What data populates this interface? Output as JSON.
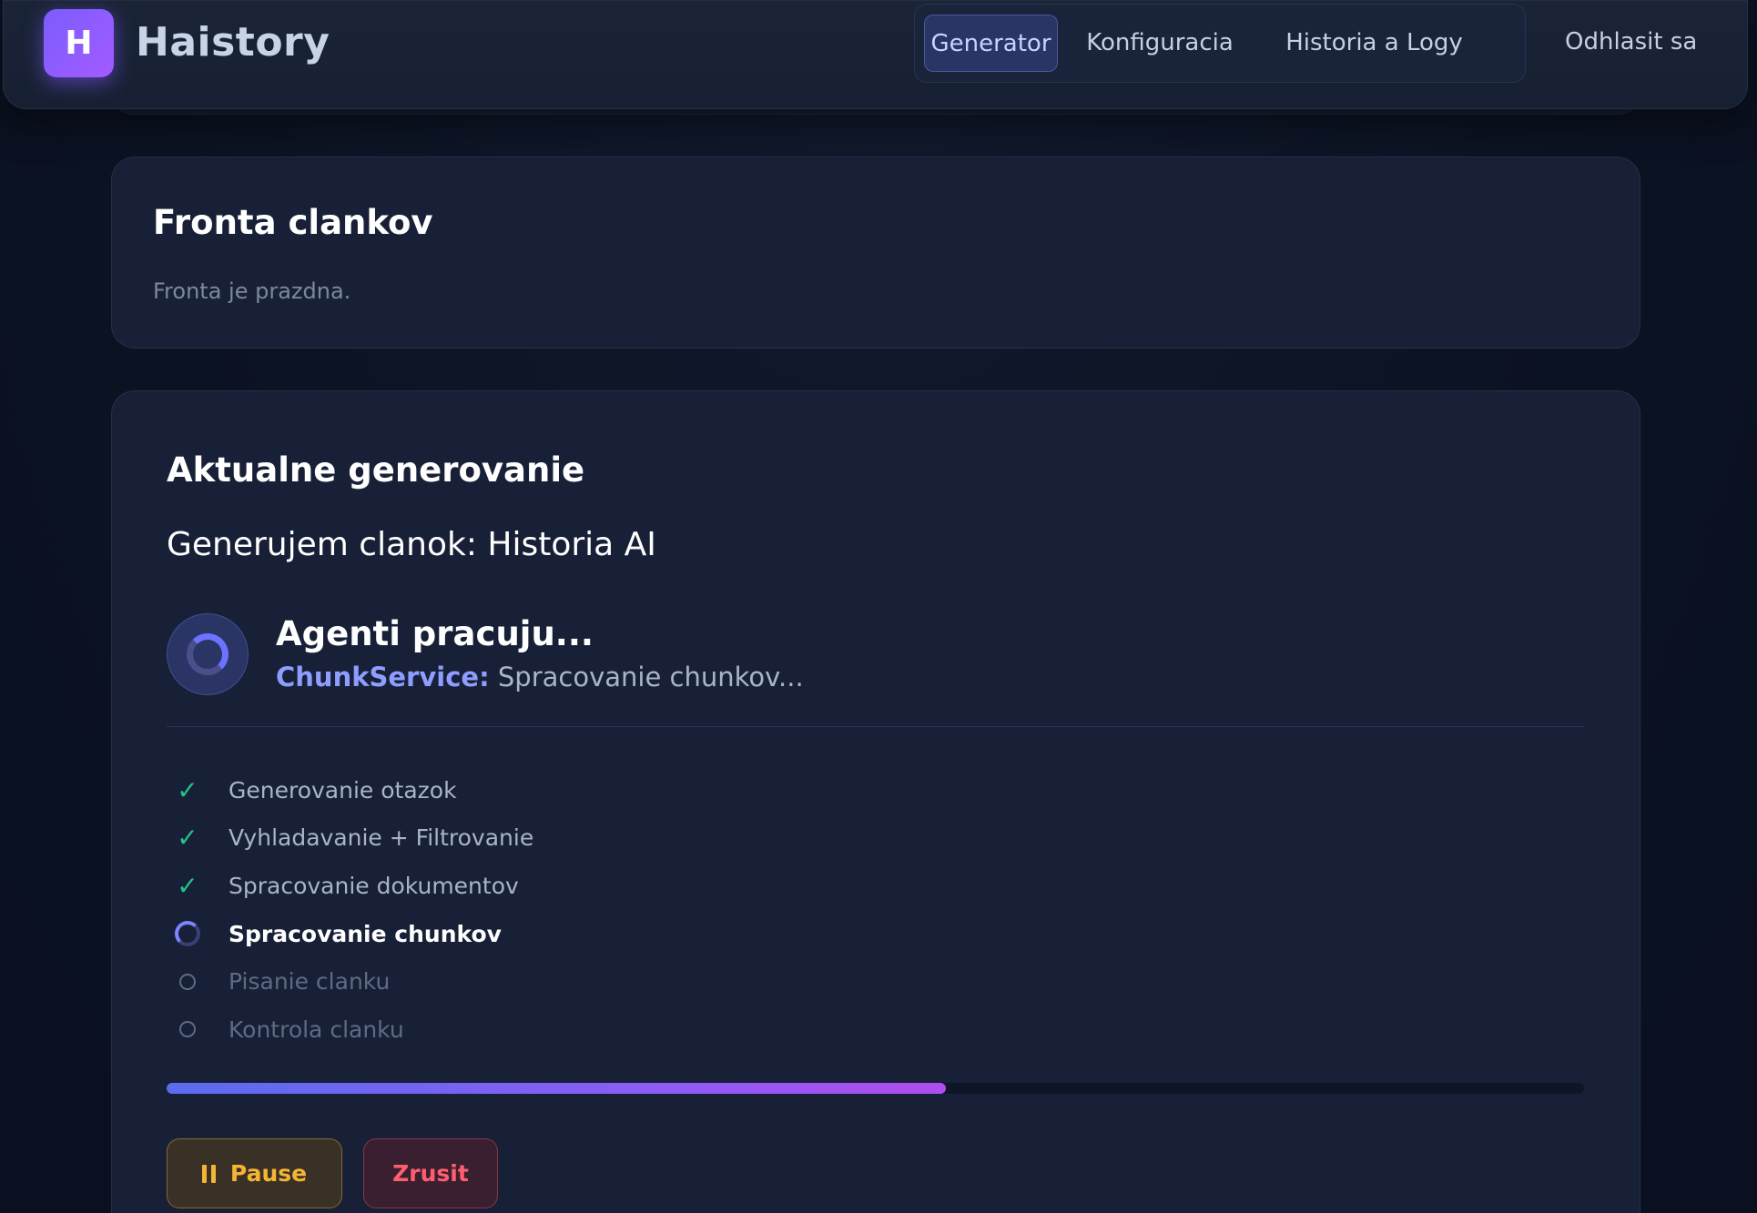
{
  "app": {
    "logo_letter": "H",
    "name": "Haistory"
  },
  "nav": {
    "tabs": [
      {
        "label": "Generator",
        "active": true
      },
      {
        "label": "Konfiguracia",
        "active": false
      },
      {
        "label": "Historia a Logy",
        "active": false
      }
    ],
    "logout_label": "Odhlasit sa"
  },
  "queue": {
    "title": "Fronta clankov",
    "empty_text": "Fronta je prazdna."
  },
  "current": {
    "title": "Aktualne generovanie",
    "subtitle": "Generujem clanok: Historia AI",
    "agent_title": "Agenti pracuju...",
    "agent_name": "ChunkService:",
    "agent_status": " Spracovanie chunkov...",
    "steps": [
      {
        "label": "Generovanie otazok",
        "state": "done"
      },
      {
        "label": "Vyhladavanie + Filtrovanie",
        "state": "done"
      },
      {
        "label": "Spracovanie dokumentov",
        "state": "done"
      },
      {
        "label": "Spracovanie chunkov",
        "state": "active"
      },
      {
        "label": "Pisanie clanku",
        "state": "pending"
      },
      {
        "label": "Kontrola clanku",
        "state": "pending"
      }
    ],
    "progress_percent": 55,
    "pause_label": "Pause",
    "cancel_label": "Zrusit"
  },
  "colors": {
    "accent": "#6b73ff",
    "done": "#22c38a",
    "pause": "#f5b534",
    "cancel": "#ff5f6d"
  }
}
